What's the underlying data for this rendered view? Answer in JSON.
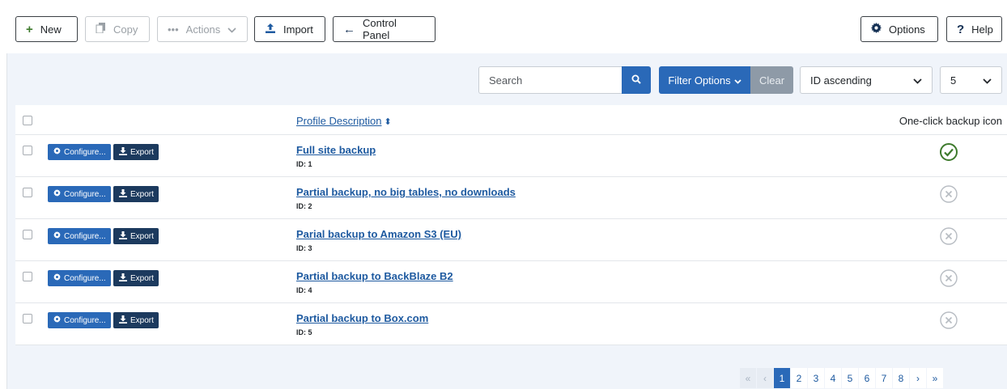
{
  "toolbar": {
    "new_label": "New",
    "copy_label": "Copy",
    "actions_label": "Actions",
    "import_label": "Import",
    "control_panel_label": "Control Panel",
    "options_label": "Options",
    "help_label": "Help"
  },
  "filters": {
    "search_placeholder": "Search",
    "filter_options_label": "Filter Options",
    "clear_label": "Clear",
    "ordering_value": "ID ascending",
    "limit_value": "5"
  },
  "table": {
    "col_description": "Profile Description",
    "col_icon": "One-click backup icon",
    "configure_label": "Configure...",
    "export_label": "Export",
    "rows": [
      {
        "title": "Full site backup",
        "id": "ID: 1",
        "one_click": true
      },
      {
        "title": "Partial backup, no big tables, no downloads",
        "id": "ID: 2",
        "one_click": false
      },
      {
        "title": "Parial backup to Amazon S3 (EU)",
        "id": "ID: 3",
        "one_click": false
      },
      {
        "title": "Partial backup to BackBlaze B2",
        "id": "ID: 4",
        "one_click": false
      },
      {
        "title": "Partial backup to Box.com",
        "id": "ID: 5",
        "one_click": false
      }
    ]
  },
  "pagination": {
    "first": "«",
    "prev": "‹",
    "pages": [
      "1",
      "2",
      "3",
      "4",
      "5",
      "6",
      "7",
      "8"
    ],
    "current": "1",
    "next": "›",
    "last": "»"
  },
  "colors": {
    "accent": "#2a69b8",
    "dark_button": "#1c3a5e",
    "check": "#3d7a2c",
    "inactive": "#b7bcc2"
  }
}
